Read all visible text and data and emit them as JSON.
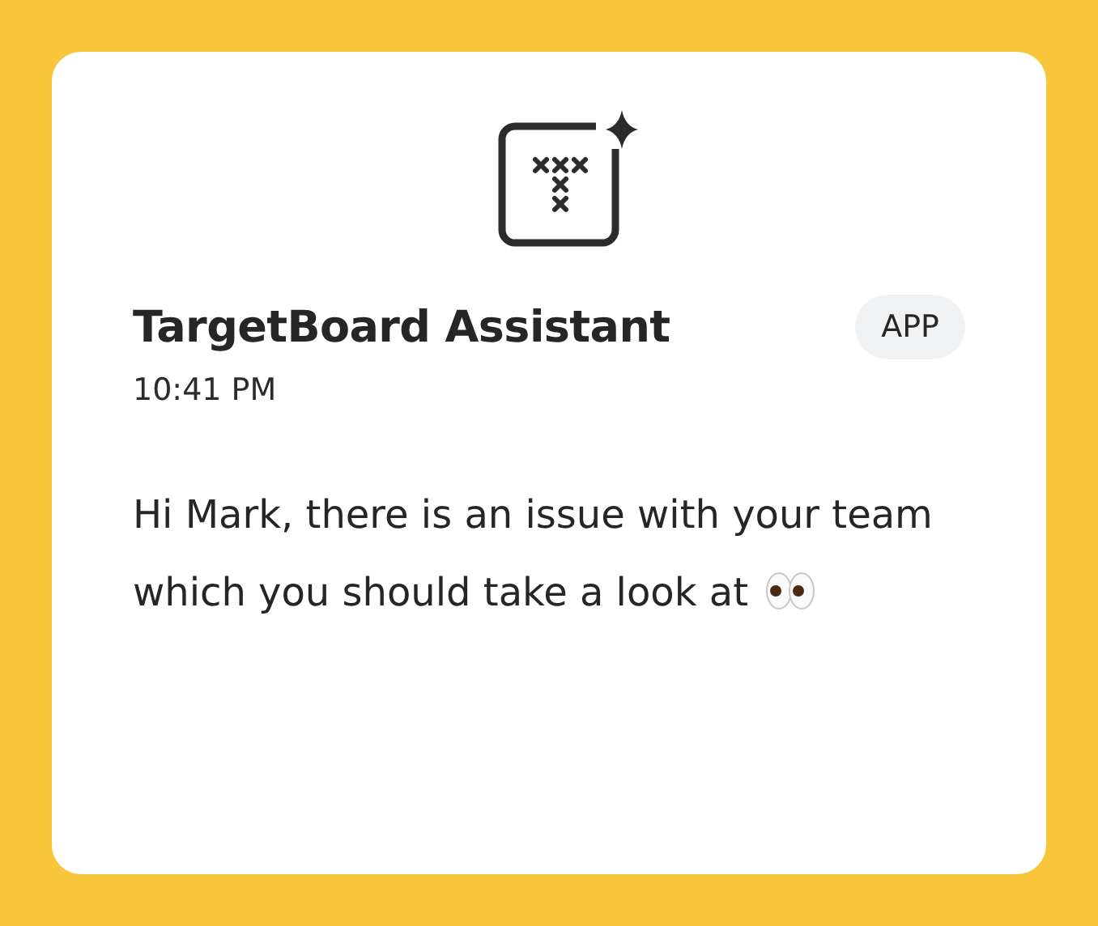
{
  "message": {
    "sender": "TargetBoard Assistant",
    "badge": "APP",
    "time": "10:41 PM",
    "text": "Hi Mark, there is an issue with your team which you should take a look at"
  }
}
